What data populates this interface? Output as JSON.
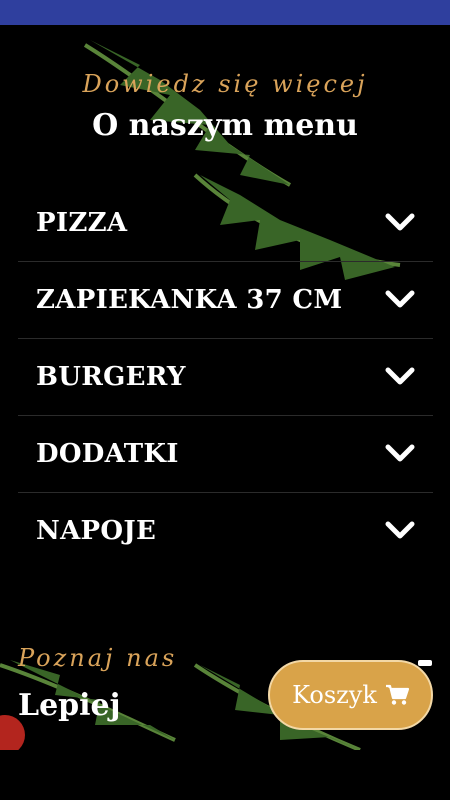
{
  "header": {
    "subtitle": "Dowiedz się więcej",
    "title": "O naszym menu"
  },
  "menu": {
    "items": [
      {
        "label": "PIZZA"
      },
      {
        "label": "ZAPIEKANKA 37 CM"
      },
      {
        "label": "BURGERY"
      },
      {
        "label": "DODATKI"
      },
      {
        "label": "NAPOJE"
      }
    ]
  },
  "about": {
    "subtitle": "Poznaj nas",
    "title": "Lepiej"
  },
  "cart": {
    "label": "Koszyk",
    "icon": "shopping-cart-icon"
  },
  "colors": {
    "status_bar": "#2f3f9e",
    "accent": "#d9a349",
    "background": "#000000"
  }
}
